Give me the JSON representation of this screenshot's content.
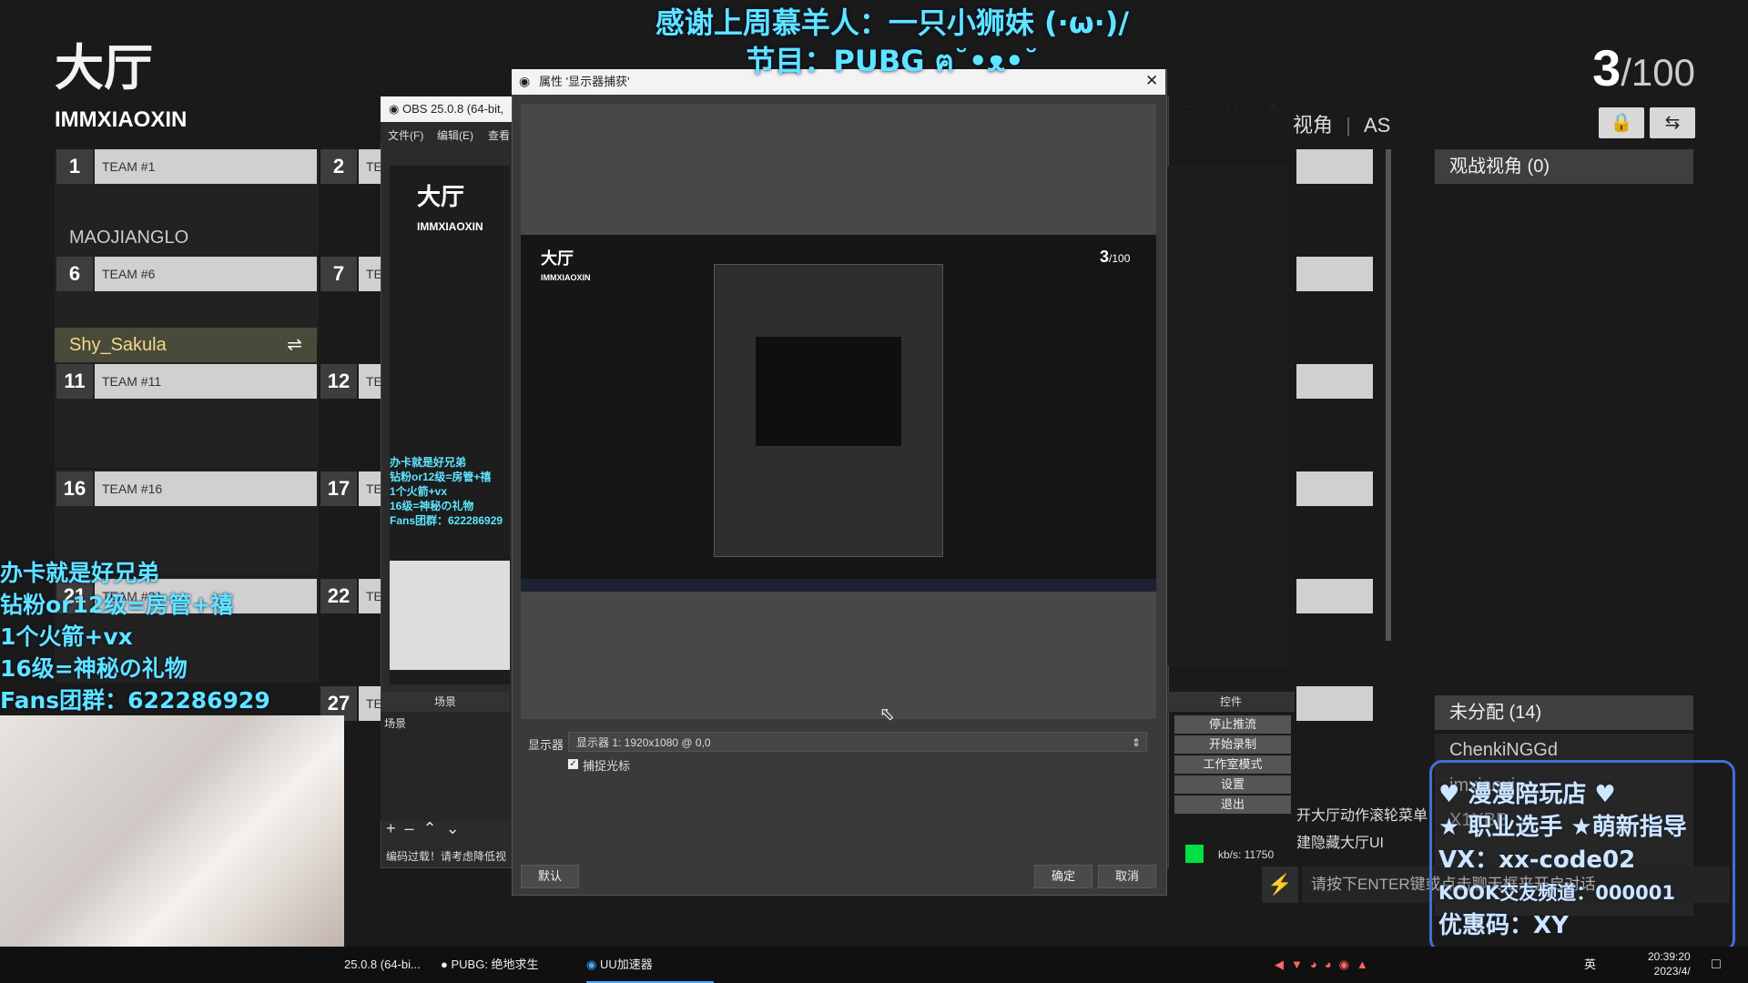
{
  "lobby": {
    "title": "大厅",
    "host": "IMMXIAOXIN",
    "count_current": "3",
    "count_total": "/100",
    "view_tab": "视角",
    "as_tab": "AS",
    "spectator_header": "观战视角 (0)",
    "unassigned_header": "未分配 (14)",
    "unassigned": [
      "ChenkiNGGd",
      "imxiaoxi",
      "X1XBB"
    ],
    "slots": [
      {
        "n": "1",
        "team": "TEAM #1"
      },
      {
        "n": "6",
        "team": "TEAM #6"
      },
      {
        "n": "11",
        "team": "TEAM #11"
      },
      {
        "n": "16",
        "team": "TEAM #16"
      },
      {
        "n": "21",
        "team": "TEAM #21"
      }
    ],
    "slots2": [
      "2",
      "7",
      "12",
      "17",
      "22",
      "27"
    ],
    "slots2_prefix": "TE",
    "player_maojiang": "MAOJIANGLO",
    "player_shy": "Shy_Sakula",
    "hint1": "开大厅动作滚轮菜单",
    "hint2": "建隐藏大厅UI",
    "chat_placeholder": "请按下ENTER键或点击聊天框来开启对话"
  },
  "overlay": {
    "top_line1": "感谢上周慕羊人：一只小狮妹 (·ω·)/",
    "top_line2": "节目：PUBG ฅ˘•ᴥ•˘",
    "left_lines": [
      "办卡就是好兄弟",
      "钻粉or12级=房管+禧",
      "1个火箭+vx",
      "16级=神秘の礼物",
      "Fans团群：622286929"
    ],
    "right_lines": [
      "♥ 漫漫陪玩店 ♥",
      "★ 职业选手 ★萌新指导",
      "VX：xx-code02",
      "KOOK交友频道：000001",
      "优惠码：XY"
    ]
  },
  "obs": {
    "title": "OBS 25.0.8 (64-bit,",
    "menu": [
      "文件(F)",
      "编辑(E)",
      "查看"
    ],
    "scenes_label": "场景",
    "scene_item": "场景",
    "controls_label": "控件",
    "controls": [
      "停止推流",
      "开始录制",
      "工作室模式",
      "设置",
      "退出"
    ],
    "status_warning": "编码过载！请考虑降低视",
    "bitrate": "kb/s: 11750"
  },
  "dialog": {
    "title": "属性 '显示器捕获'",
    "display_label": "显示器",
    "display_value": "显示器 1: 1920x1080 @ 0,0",
    "capture_cursor": "捕捉光标",
    "defaults_button": "默认",
    "ok_button": "确定",
    "cancel_button": "取消"
  },
  "taskbar": {
    "items": [
      "25.0.8 (64-bi...",
      "PUBG: 绝地求生",
      "UU加速器"
    ],
    "ime": "英",
    "time": "20:39:20",
    "date": "2023/4/"
  },
  "colors": {
    "overlay_cyan": "#5ee6ff",
    "live_green": "#00e040",
    "accent_gold": "#f2d98a"
  }
}
